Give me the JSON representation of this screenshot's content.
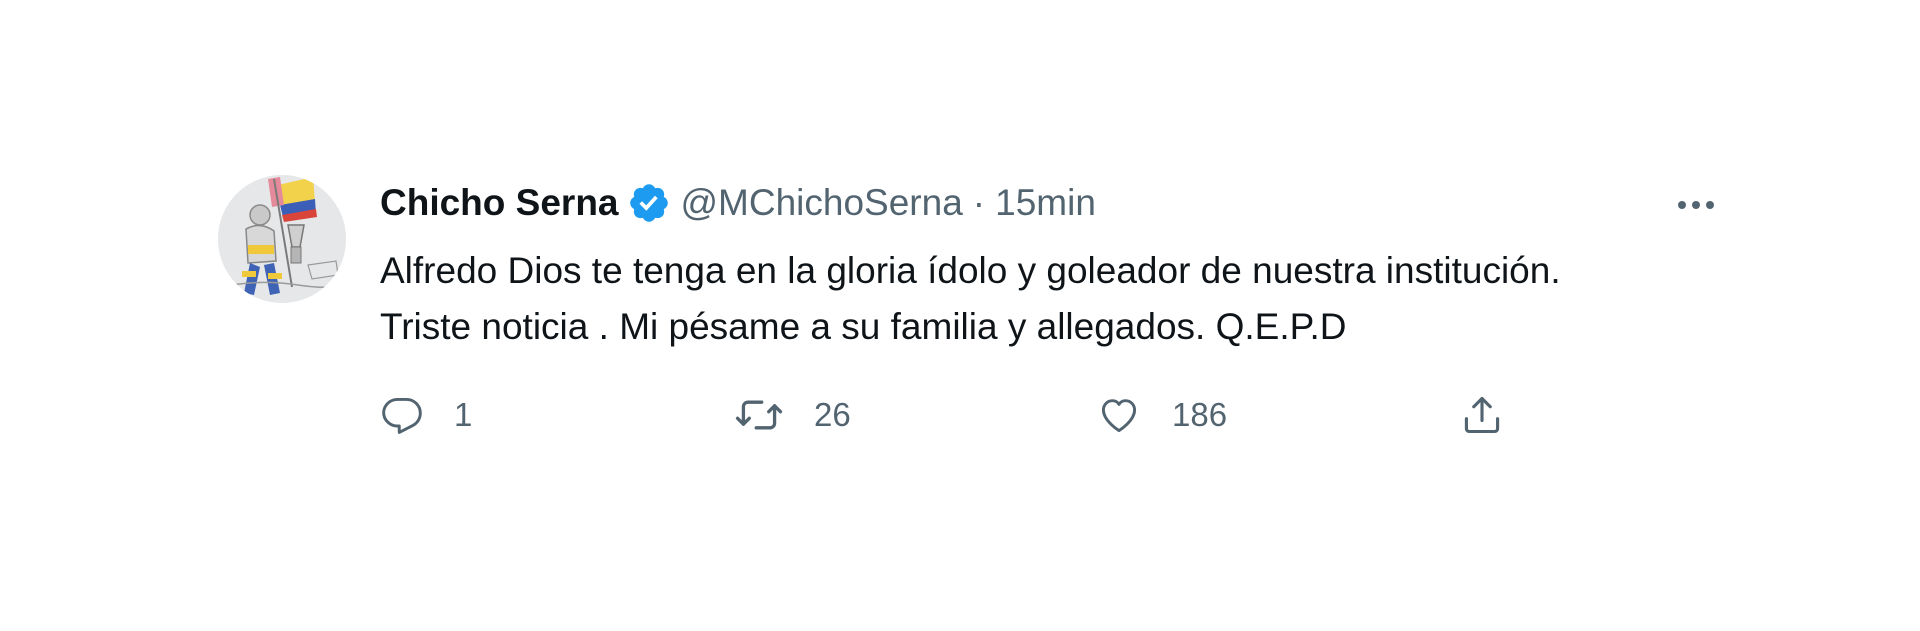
{
  "tweet": {
    "author": {
      "display_name": "Chicho Serna",
      "handle": "@MChichoSerna",
      "verified": true
    },
    "separator": "·",
    "time": "15min",
    "text_lines": [
      "Alfredo Dios te tenga en la gloria ídolo y goleador de nuestra institución.",
      "Triste noticia . Mi pésame a su familia y allegados. Q.E.P.D"
    ],
    "actions": {
      "reply": {
        "icon": "reply-icon",
        "count": "1"
      },
      "retweet": {
        "icon": "retweet-icon",
        "count": "26"
      },
      "like": {
        "icon": "heart-icon",
        "count": "186"
      },
      "share": {
        "icon": "share-icon"
      }
    },
    "more_icon": "more-options-icon"
  },
  "colors": {
    "text_primary": "#0f1419",
    "text_secondary": "#536471",
    "verified_blue": "#1d9bf0",
    "background": "#ffffff"
  }
}
